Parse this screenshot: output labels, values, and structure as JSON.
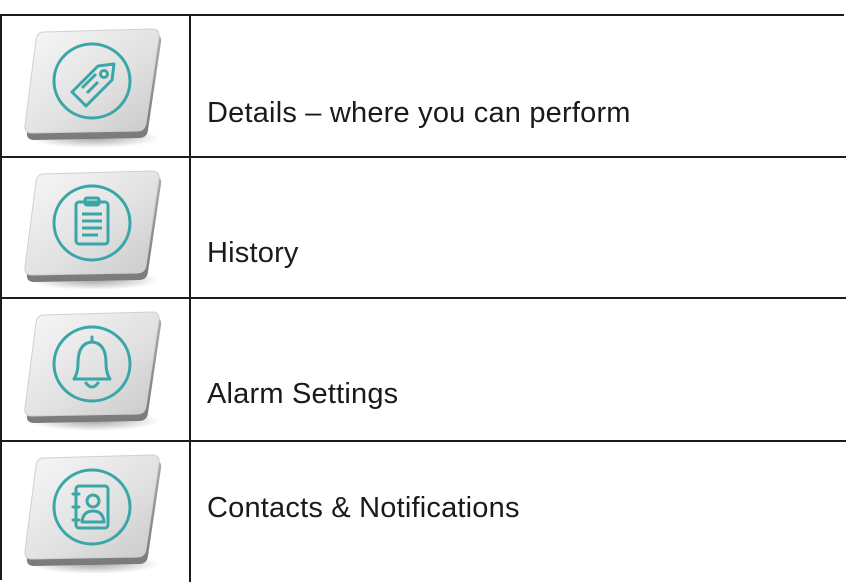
{
  "menu": {
    "items": [
      {
        "icon": "tag-icon",
        "label": "Details – where you can perform"
      },
      {
        "icon": "clipboard-icon",
        "label": "History"
      },
      {
        "icon": "bell-icon",
        "label": "Alarm Settings"
      },
      {
        "icon": "contact-card-icon",
        "label": "Contacts & Notifications"
      }
    ]
  },
  "colors": {
    "icon_ring": "#3aa6a8",
    "tile_face": "#e4e4e4",
    "border": "#1c1c1c",
    "text": "#1a1a1a"
  }
}
